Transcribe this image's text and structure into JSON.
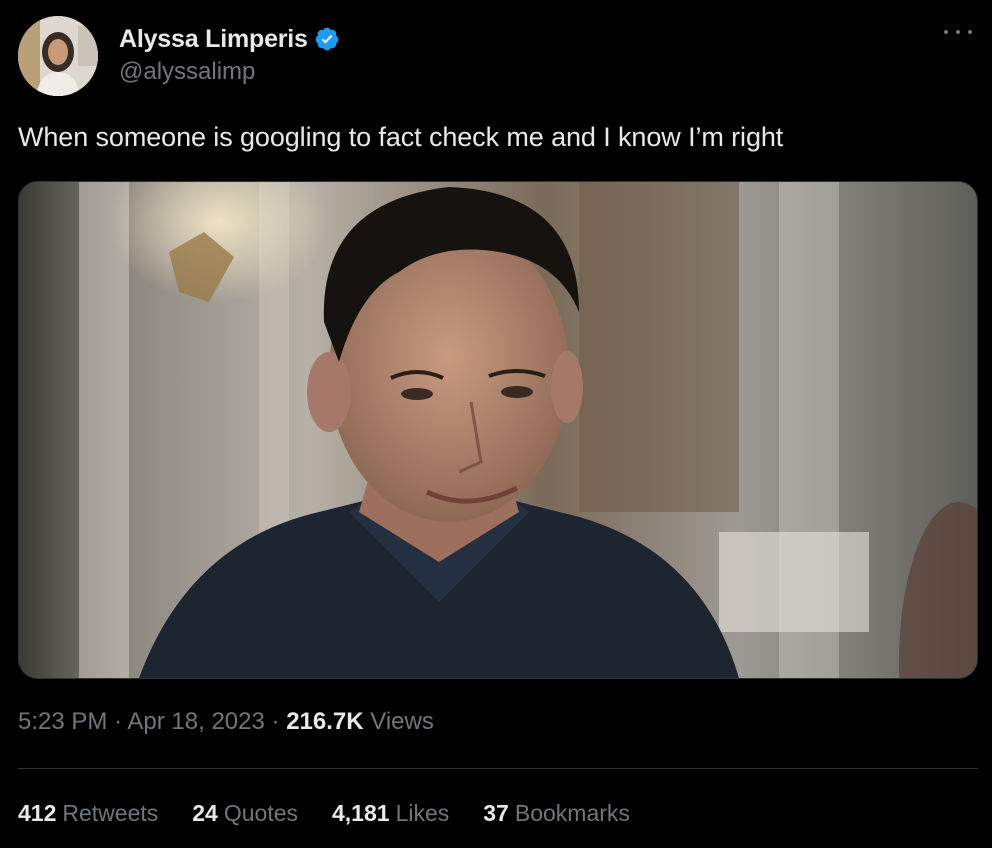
{
  "author": {
    "display_name": "Alyssa Limperis",
    "handle": "@alyssalimp",
    "verified": true,
    "avatar_icon": "avatar-photo"
  },
  "tweet": {
    "text": "When someone is googling to fact check me and I know I’m right",
    "time": "5:23 PM",
    "date": "Apr 18, 2023",
    "views_count": "216.7K",
    "views_label": "Views"
  },
  "stats": {
    "retweets_count": "412",
    "retweets_label": "Retweets",
    "quotes_count": "24",
    "quotes_label": "Quotes",
    "likes_count": "4,181",
    "likes_label": "Likes",
    "bookmarks_count": "37",
    "bookmarks_label": "Bookmarks"
  },
  "icons": {
    "verified": "verified-badge-icon",
    "more": "more-options-icon"
  },
  "colors": {
    "background": "#000000",
    "text_primary": "#e7e9ea",
    "text_secondary": "#71767b",
    "divider": "#2f3336",
    "verified_blue": "#1d9bf0"
  }
}
